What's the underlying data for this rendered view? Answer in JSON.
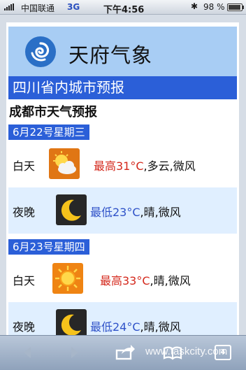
{
  "status_bar": {
    "carrier": "中国联通",
    "network": "3G",
    "time": "下午4:56",
    "battery_percent": "98 %",
    "battery_level": 0.98
  },
  "header": {
    "app_title": "天府气象"
  },
  "province_title": "四川省内城市预报",
  "city_title": "成都市天气预报",
  "days": [
    {
      "date": "6月22号星期三",
      "day": {
        "label": "白天",
        "icon": "partly-cloudy-icon",
        "temp": "最高31°C",
        "desc": ",多云,微风"
      },
      "night": {
        "label": "夜晚",
        "icon": "moon-icon",
        "temp": "最低23°C",
        "desc": ",晴,微风"
      }
    },
    {
      "date": "6月23号星期四",
      "day": {
        "label": "白天",
        "icon": "sun-icon",
        "temp": "最高33°C",
        "desc": ",晴,微风"
      },
      "night": {
        "label": "夜晚",
        "icon": "moon-icon",
        "temp": "最低24°C",
        "desc": ",晴,微风"
      }
    }
  ],
  "toolbar": {
    "watermark": "www.taskcity.com",
    "tabs_count": "4"
  },
  "colors": {
    "header_bg": "#a8cdf4",
    "bar_blue": "#2b5fd8",
    "temp_high": "#d4281c",
    "temp_low": "#2f52c8",
    "row_alt": "#e0efff"
  }
}
